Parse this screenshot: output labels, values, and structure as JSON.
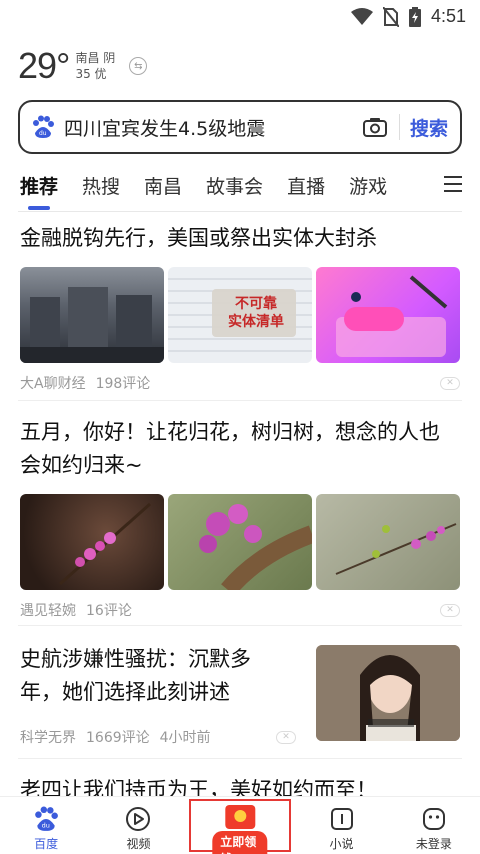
{
  "status_bar": {
    "time": "4:51",
    "icons": [
      "wifi-icon",
      "no-sim-icon",
      "battery-icon"
    ]
  },
  "weather": {
    "temp": "29°",
    "city": "南昌",
    "condition": "阴",
    "aqi": "35 优"
  },
  "search": {
    "query": "四川宜宾发生4.5级地震",
    "button": "搜索"
  },
  "tabs": [
    "推荐",
    "热搜",
    "南昌",
    "故事会",
    "直播",
    "游戏"
  ],
  "feed": [
    {
      "title": "金融脱钩先行，美国或祭出实体大封杀",
      "source": "大A聊财经",
      "comments": "198评论",
      "img_overlay": "不可靠\n实体清单"
    },
    {
      "title": "五月，你好！让花归花，树归树，想念的人也会如约归来~",
      "source": "遇见轻婉",
      "comments": "16评论"
    },
    {
      "title": "史航涉嫌性骚扰：沉默多年，她们选择此刻讲述",
      "source": "科学无界",
      "comments": "1669评论",
      "time": "4小时前"
    },
    {
      "title": "老四让我们持币为王，美好如约而至！"
    }
  ],
  "bottom_nav": {
    "home": "百度",
    "video": "视频",
    "redpack": "立即领钱",
    "novel": "小说",
    "profile": "未登录"
  },
  "colors": {
    "accent": "#3b5bdb",
    "red": "#ef3b2a"
  }
}
